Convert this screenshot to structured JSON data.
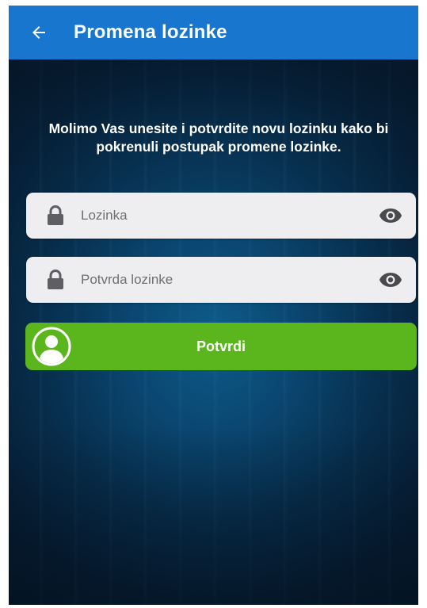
{
  "header": {
    "title": "Promena lozinke",
    "back_icon": "arrow-left-icon",
    "background_color": "#1976cf"
  },
  "instruction": "Molimo Vas unesite i potvrdite novu lozinku kako bi pokrenuli postupak promene lozinke.",
  "form": {
    "password": {
      "placeholder": "Lozinka",
      "value": "",
      "leading_icon": "lock-icon",
      "trailing_icon": "eye-icon"
    },
    "confirm_password": {
      "placeholder": "Potvrda lozinke",
      "value": "",
      "leading_icon": "lock-icon",
      "trailing_icon": "eye-icon"
    },
    "submit": {
      "label": "Potvrdi",
      "icon": "user-avatar-icon",
      "color": "#5bb51d"
    }
  }
}
